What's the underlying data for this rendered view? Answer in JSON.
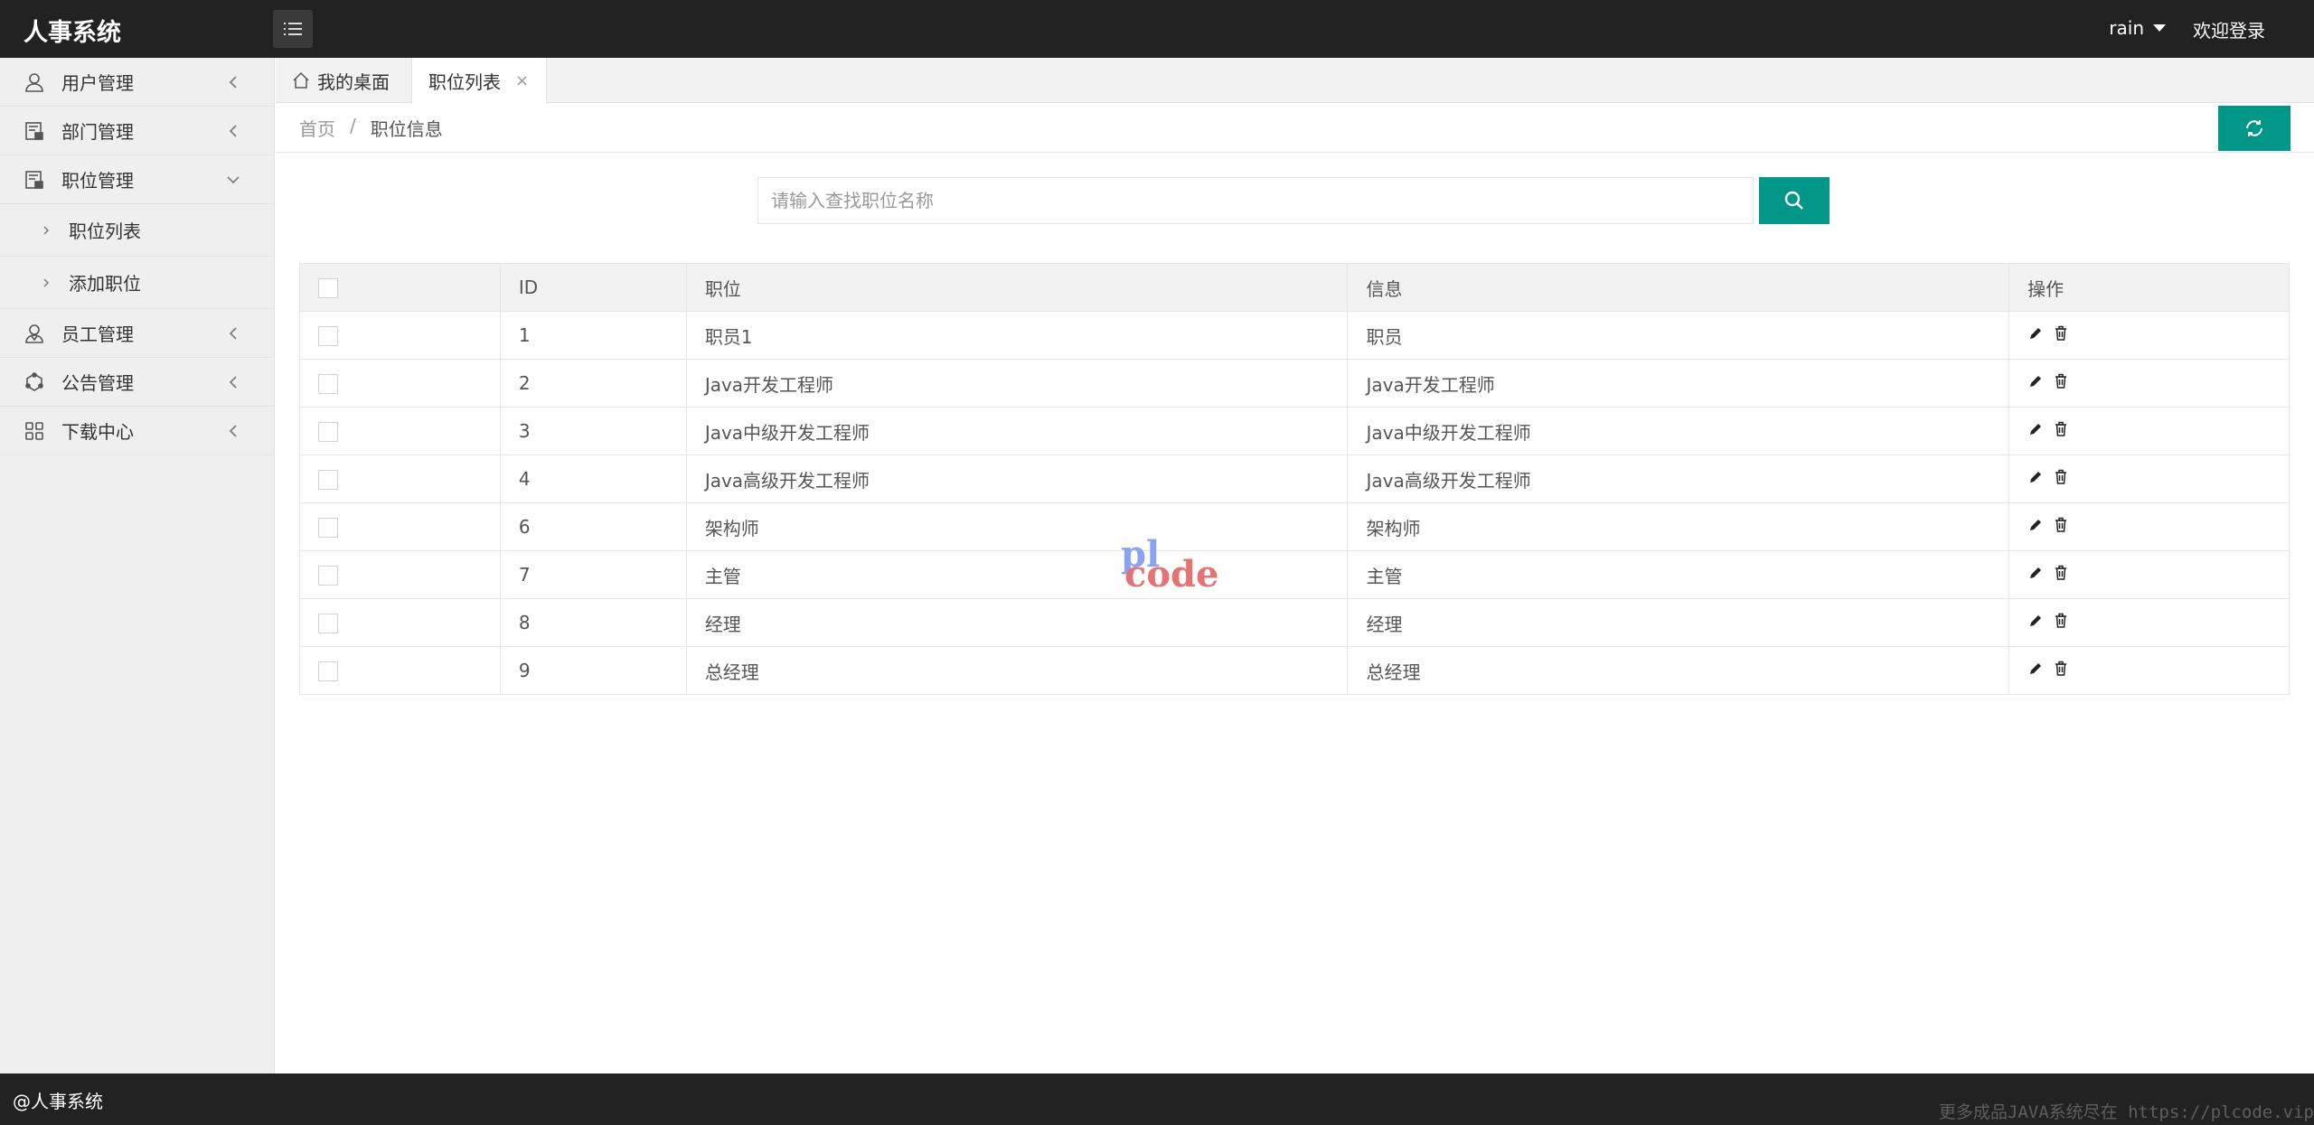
{
  "header": {
    "title": "人事系统",
    "user": "rain",
    "welcome": "欢迎登录"
  },
  "sidebar": {
    "items": [
      {
        "label": "用户管理",
        "icon": "user-icon"
      },
      {
        "label": "部门管理",
        "icon": "department-icon"
      },
      {
        "label": "职位管理",
        "icon": "position-icon",
        "expanded": true,
        "children": [
          {
            "label": "职位列表"
          },
          {
            "label": "添加职位"
          }
        ]
      },
      {
        "label": "员工管理",
        "icon": "employee-icon"
      },
      {
        "label": "公告管理",
        "icon": "notice-icon"
      },
      {
        "label": "下载中心",
        "icon": "download-center-icon"
      }
    ]
  },
  "tabs": [
    {
      "label": "我的桌面",
      "icon": "home-icon"
    },
    {
      "label": "职位列表",
      "close": "×",
      "active": true
    }
  ],
  "breadcrumb": {
    "home": "首页",
    "separator": "/",
    "current": "职位信息"
  },
  "search": {
    "placeholder": "请输入查找职位名称"
  },
  "table": {
    "columns": [
      "ID",
      "职位",
      "信息",
      "操作"
    ],
    "rows": [
      {
        "id": "1",
        "name": "职员1",
        "info": "职员"
      },
      {
        "id": "2",
        "name": "Java开发工程师",
        "info": "Java开发工程师"
      },
      {
        "id": "3",
        "name": "Java中级开发工程师",
        "info": "Java中级开发工程师"
      },
      {
        "id": "4",
        "name": "Java高级开发工程师",
        "info": "Java高级开发工程师"
      },
      {
        "id": "6",
        "name": "架构师",
        "info": "架构师"
      },
      {
        "id": "7",
        "name": "主管",
        "info": "主管"
      },
      {
        "id": "8",
        "name": "经理",
        "info": "经理"
      },
      {
        "id": "9",
        "name": "总经理",
        "info": "总经理"
      }
    ]
  },
  "watermark": {
    "line1": "pl",
    "line2": "code"
  },
  "footer": {
    "copyright": "@人事系统",
    "promo": "更多成品JAVA系统尽在 https://plcode.vip"
  },
  "colors": {
    "header_bg": "#222222",
    "accent": "#009688",
    "sidebar_bg": "#efefef"
  }
}
